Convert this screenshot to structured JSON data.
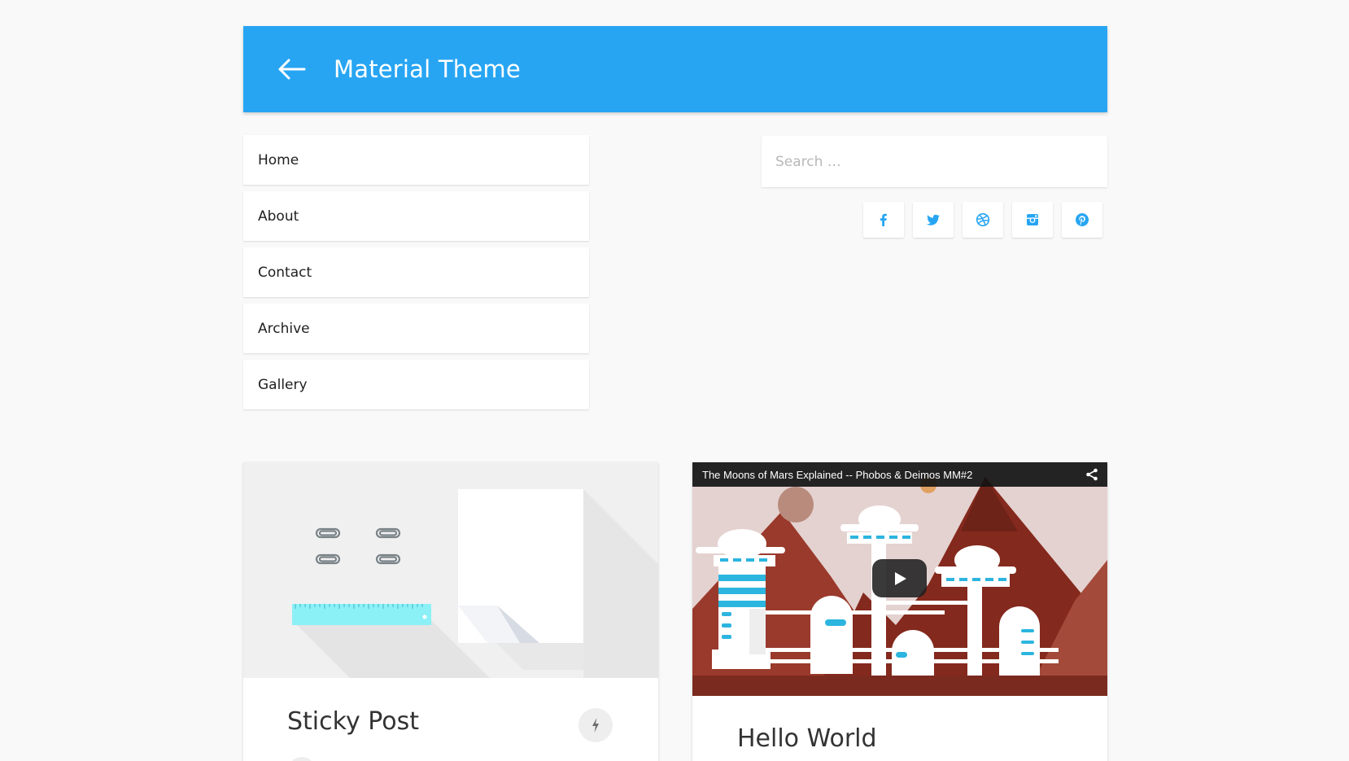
{
  "header": {
    "title": "Material Theme"
  },
  "nav": {
    "items": [
      {
        "label": "Home"
      },
      {
        "label": "About"
      },
      {
        "label": "Contact"
      },
      {
        "label": "Archive"
      },
      {
        "label": "Gallery"
      }
    ]
  },
  "search": {
    "placeholder": "Search …"
  },
  "social": [
    "facebook-icon",
    "twitter-icon",
    "dribbble-icon",
    "instagram-icon",
    "pinterest-icon"
  ],
  "colors": {
    "primary": "#27a5f3",
    "social_icon": "#27a5f3",
    "background": "#f9f9f9"
  },
  "posts": [
    {
      "title": "Sticky Post"
    },
    {
      "title": "Hello World",
      "video_title": "The Moons of Mars Explained -- Phobos & Deimos MM#2"
    }
  ]
}
